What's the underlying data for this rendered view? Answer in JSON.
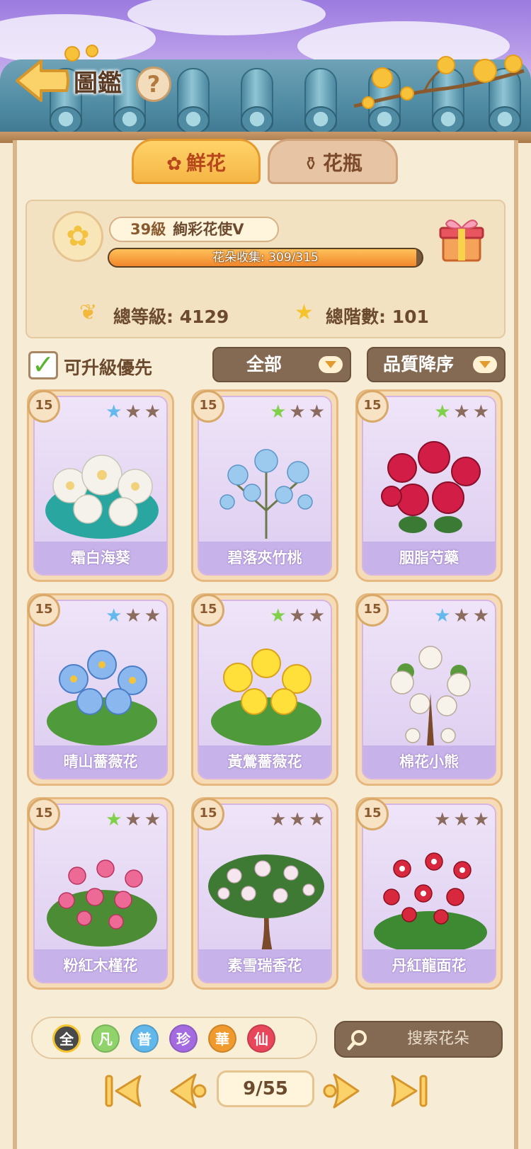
{
  "header": {
    "title": "圖鑑",
    "help": "?"
  },
  "tabs": [
    {
      "label": "鮮花",
      "icon": "rose-icon",
      "active": true
    },
    {
      "label": "花瓶",
      "icon": "vase-icon",
      "active": false
    }
  ],
  "level": {
    "level_text": "39級",
    "rank": "絢彩花使Ⅴ",
    "progress_label": "花朵收集: 309/315",
    "progress_fraction": 0.981,
    "total_level": "總等級: 4129",
    "total_stars": "總階數: 101"
  },
  "filters": {
    "upgrade_first": "可升級優先",
    "category": "全部",
    "sort": "品質降序"
  },
  "cards": [
    {
      "name": "霜白海葵",
      "level": "15",
      "stars": [
        "blue",
        "gray",
        "gray"
      ]
    },
    {
      "name": "碧落夾竹桃",
      "level": "15",
      "stars": [
        "green",
        "gray",
        "gray"
      ]
    },
    {
      "name": "胭脂芍藥",
      "level": "15",
      "stars": [
        "green",
        "gray",
        "gray"
      ]
    },
    {
      "name": "晴山薔薇花",
      "level": "15",
      "stars": [
        "blue",
        "gray",
        "gray"
      ]
    },
    {
      "name": "黃鶯薔薇花",
      "level": "15",
      "stars": [
        "green",
        "gray",
        "gray"
      ]
    },
    {
      "name": "棉花小熊",
      "level": "15",
      "stars": [
        "blue",
        "gray",
        "gray"
      ]
    },
    {
      "name": "粉紅木槿花",
      "level": "15",
      "stars": [
        "green",
        "gray",
        "gray"
      ]
    },
    {
      "name": "素雪瑞香花",
      "level": "15",
      "stars": [
        "gray",
        "gray",
        "gray"
      ]
    },
    {
      "name": "丹紅龍面花",
      "level": "15",
      "stars": [
        "gray",
        "gray",
        "gray"
      ]
    }
  ],
  "quality_filters": [
    {
      "label": "全",
      "color": "#4a4a4a"
    },
    {
      "label": "凡",
      "color": "#8fd36a"
    },
    {
      "label": "普",
      "color": "#62b8ea"
    },
    {
      "label": "珍",
      "color": "#a46be0"
    },
    {
      "label": "華",
      "color": "#f09a2e"
    },
    {
      "label": "仙",
      "color": "#e8465a"
    }
  ],
  "search": {
    "placeholder": "搜索花朵"
  },
  "pagination": {
    "page": "9/55"
  },
  "colors": {
    "star_blue": "#63b8ee",
    "star_green": "#7fd14a",
    "star_gray": "#8a6b5e"
  }
}
